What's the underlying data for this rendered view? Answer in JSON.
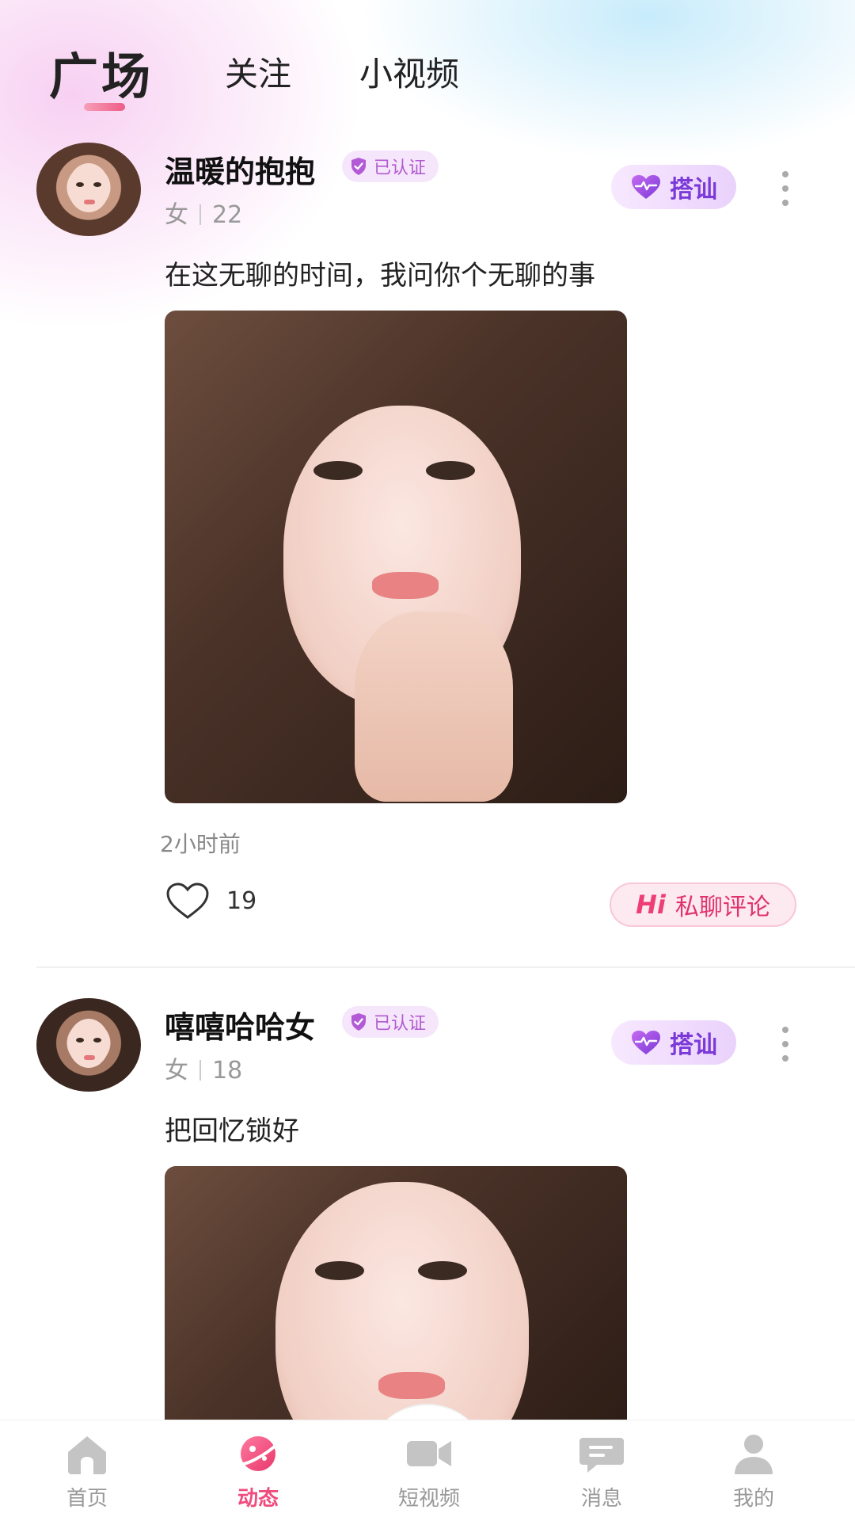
{
  "top_tabs": {
    "active": "广场",
    "follow": "关注",
    "short_video": "小视频"
  },
  "posts": [
    {
      "username": "温暖的抱抱",
      "verified_label": "已认证",
      "gender": "女",
      "age": "22",
      "flirt_label": "搭讪",
      "caption": "在这无聊的时间，我问你个无聊的事",
      "time": "2小时前",
      "likes": "19",
      "chat_hi": "Hi",
      "chat_label": "私聊评论"
    },
    {
      "username": "嘻嘻哈哈女",
      "verified_label": "已认证",
      "gender": "女",
      "age": "18",
      "flirt_label": "搭讪",
      "caption": "把回忆锁好"
    }
  ],
  "bottom_nav": {
    "home": "首页",
    "feed": "动态",
    "video": "短视频",
    "messages": "消息",
    "me": "我的"
  },
  "colors": {
    "accent": "#ef4b7c",
    "flirt": "#7b3ad8",
    "verified": "#b05ad0"
  }
}
